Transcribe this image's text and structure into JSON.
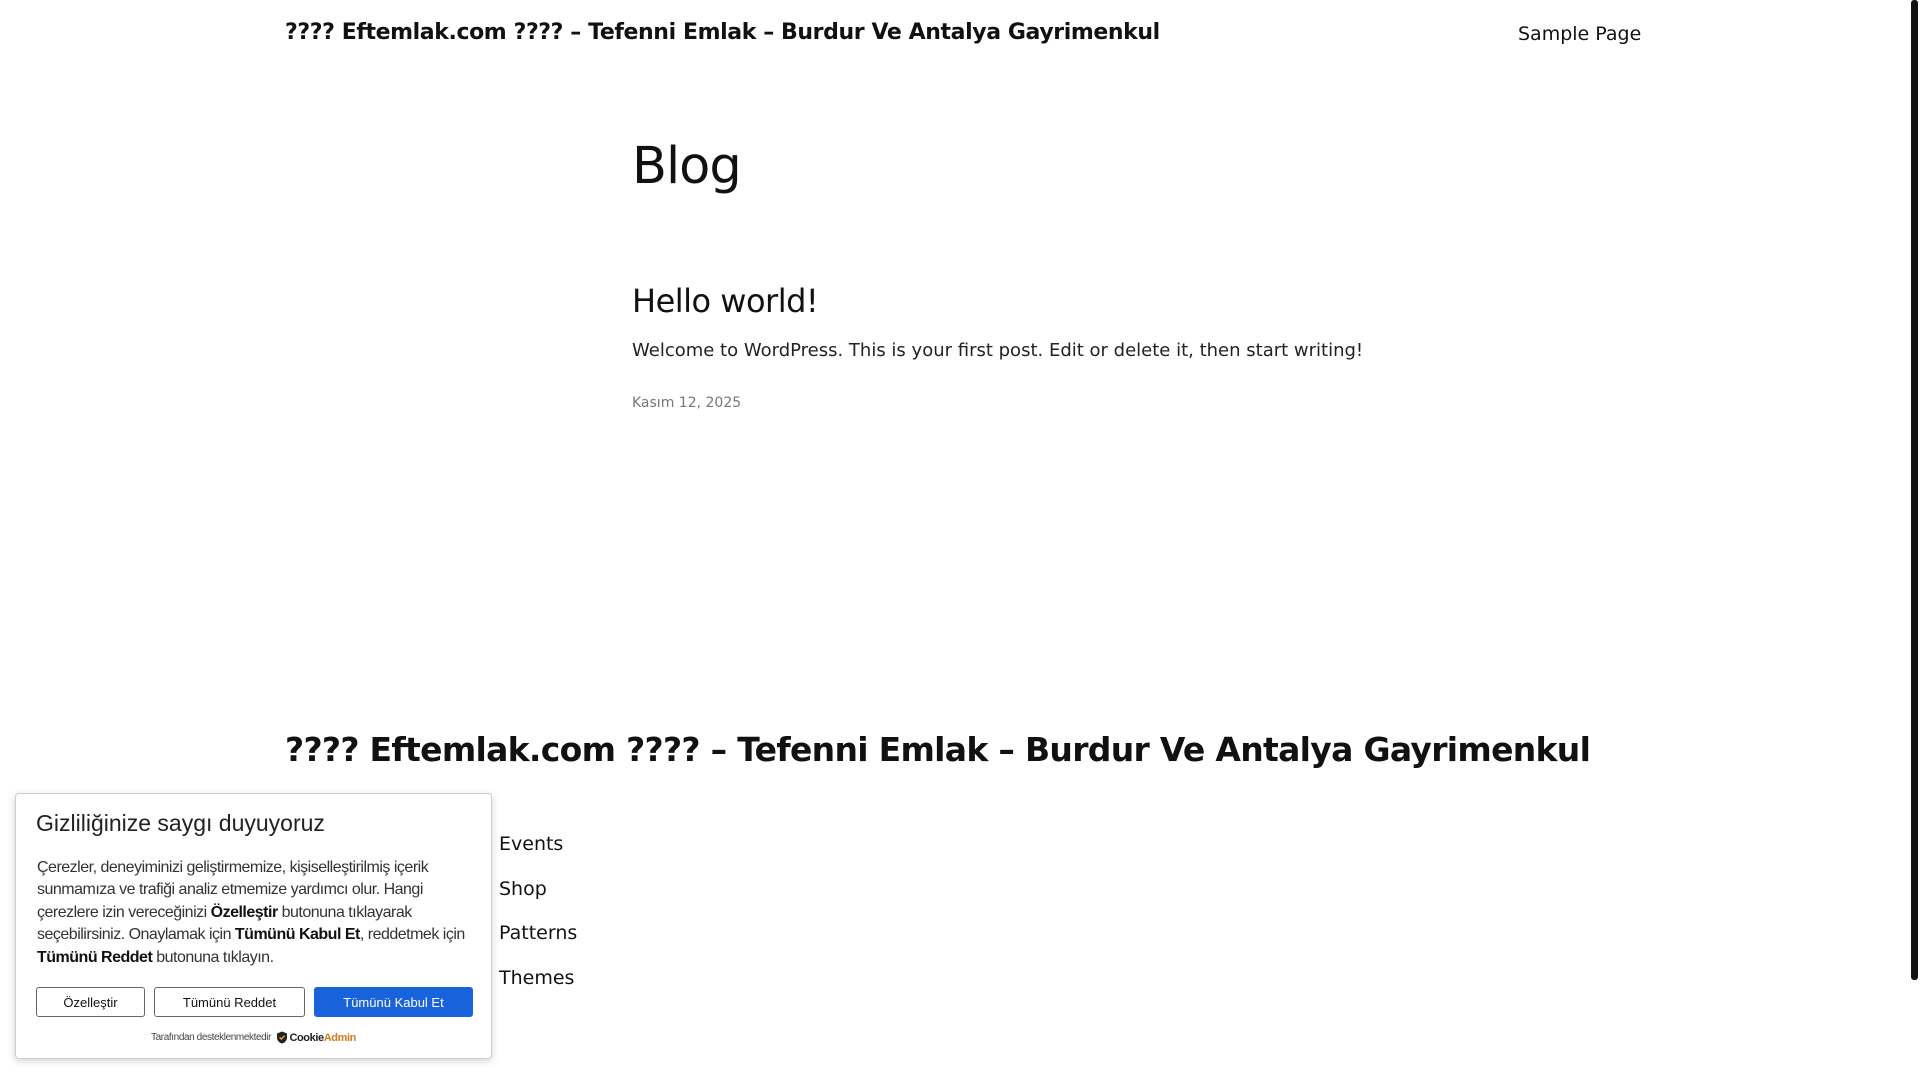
{
  "header": {
    "site_title": "???? Eftemlak.com ???? – Tefenni Emlak – Burdur Ve Antalya Gayrimenkul",
    "nav": [
      "Sample Page"
    ]
  },
  "main": {
    "page_heading": "Blog",
    "posts": [
      {
        "title": "Hello world!",
        "excerpt": "Welcome to WordPress. This is your first post. Edit or delete it, then start writing!",
        "date": "Kasım 12, 2025"
      }
    ]
  },
  "footer": {
    "site_title": "???? Eftemlak.com ???? – Tefenni Emlak – Burdur Ve Antalya Gayrimenkul",
    "links": [
      "Events",
      "Shop",
      "Patterns",
      "Themes"
    ]
  },
  "cookie_banner": {
    "heading": "Gizliliğinize saygı duyuyoruz",
    "body": {
      "part1": "Çerezler, deneyiminizi geliştirmemize, kişiselleştirilmiş içerik sunmamıza ve trafiği analiz etmemize yardımcı olur. Hangi çerezlere izin vereceğinizi ",
      "bold1": "Özelleştir",
      "part2": " butonuna tıklayarak seçebilirsiniz. Onaylamak için ",
      "bold2": "Tümünü Kabul Et",
      "part3": ", reddetmek için ",
      "bold3": "Tümünü Reddet",
      "part4": " butonuna tıklayın."
    },
    "buttons": {
      "customize": "Özelleştir",
      "reject_all": "Tümünü Reddet",
      "accept_all": "Tümünü Kabul Et"
    },
    "powered_by": "Tarafından desteklenmektedir",
    "logo": {
      "part_a": "Cookie",
      "part_b": "Admin"
    },
    "colors": {
      "accept_bg": "#1863dc",
      "accept_text": "#ffffff"
    }
  },
  "scrollbar": {
    "thumb_color": "#111111"
  }
}
